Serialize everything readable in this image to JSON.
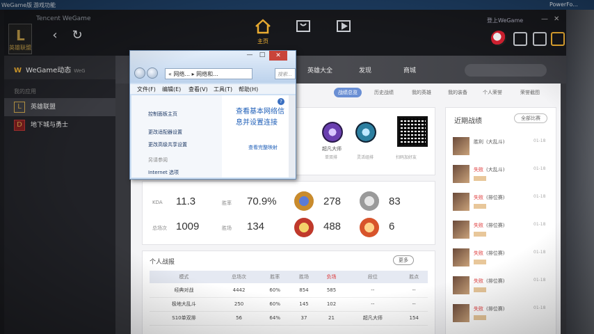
{
  "desktop": {
    "left_label": "WeGame版",
    "tab_label": "游戏功能",
    "right_label": "PowerFo..."
  },
  "app": {
    "title": "Tencent WeGame",
    "user_line": "登上WeGame",
    "home_tab_label": "主页",
    "logo_label": "英雄联盟"
  },
  "sidebar": {
    "header_title": "WeGame动态",
    "header_badge": "WeG",
    "section_label": "我的应用",
    "items": [
      {
        "label": "英雄联盟",
        "icon": "L"
      },
      {
        "label": "地下城与勇士",
        "icon": "D"
      }
    ]
  },
  "game_tabs": [
    "英雄大全",
    "发现",
    "商城"
  ],
  "sub_tabs": [
    "战绩总览",
    "历史战绩",
    "我的英雄",
    "我的装备",
    "个人荣誉",
    "荣誉截图"
  ],
  "hero_card": {
    "rank1_label": "超凡大师",
    "rank1_sub": "单双排",
    "rank2_sub": "灵活组排",
    "qr_label": "扫码加好友"
  },
  "stats": {
    "kda_label": "KDA",
    "kda_value": "11.3",
    "winrate_label": "胜率",
    "winrate_value": "70.9%",
    "total_label": "总场次",
    "total_value": "1009",
    "mvp_label": "胜场",
    "mvp_value": "134",
    "medals": [
      "278",
      "83",
      "488",
      "6"
    ]
  },
  "personal": {
    "title": "个人战报",
    "more_label": "更多",
    "columns": [
      "模式",
      "总场次",
      "胜率",
      "胜场",
      "负场",
      "段位",
      "胜点"
    ],
    "rows": [
      [
        "经典对战",
        "4442",
        "60%",
        "854",
        "585",
        "--",
        "--"
      ],
      [
        "极地大乱斗",
        "250",
        "60%",
        "145",
        "102",
        "--",
        "--"
      ],
      [
        "S10单双排",
        "56",
        "64%",
        "37",
        "21",
        "超凡大师",
        "154"
      ]
    ]
  },
  "recent": {
    "title": "近期战绩",
    "filter_label": "全部比赛",
    "items": [
      {
        "result": "胜利",
        "mode": "(大乱斗)",
        "date": "01-18",
        "win": true
      },
      {
        "result": "失败",
        "mode": "(大乱斗)",
        "date": "01-18",
        "win": false
      },
      {
        "result": "失败",
        "mode": "(排位赛)",
        "date": "01-18",
        "win": false
      },
      {
        "result": "失败",
        "mode": "(排位赛)",
        "date": "01-18",
        "win": false
      },
      {
        "result": "失败",
        "mode": "(排位赛)",
        "date": "01-18",
        "win": false
      },
      {
        "result": "失败",
        "mode": "(排位赛)",
        "date": "01-18",
        "win": false
      },
      {
        "result": "失败",
        "mode": "(排位赛)",
        "date": "01-18",
        "win": false
      }
    ]
  },
  "dialog": {
    "address": "« 网络... ▸ 网络和...",
    "search_placeholder": "搜索...",
    "menu": [
      "文件(F)",
      "编辑(E)",
      "查看(V)",
      "工具(T)",
      "帮助(H)"
    ],
    "left_links": [
      "控制面板主页",
      "更改适配器设置",
      "更改高级共享设置",
      "另请参阅",
      "Internet 选项"
    ],
    "right_heading": "查看基本网络信息并设置连接",
    "right_link": "查看完整映射",
    "close_label": "✕",
    "min_label": "—",
    "max_label": "□"
  }
}
